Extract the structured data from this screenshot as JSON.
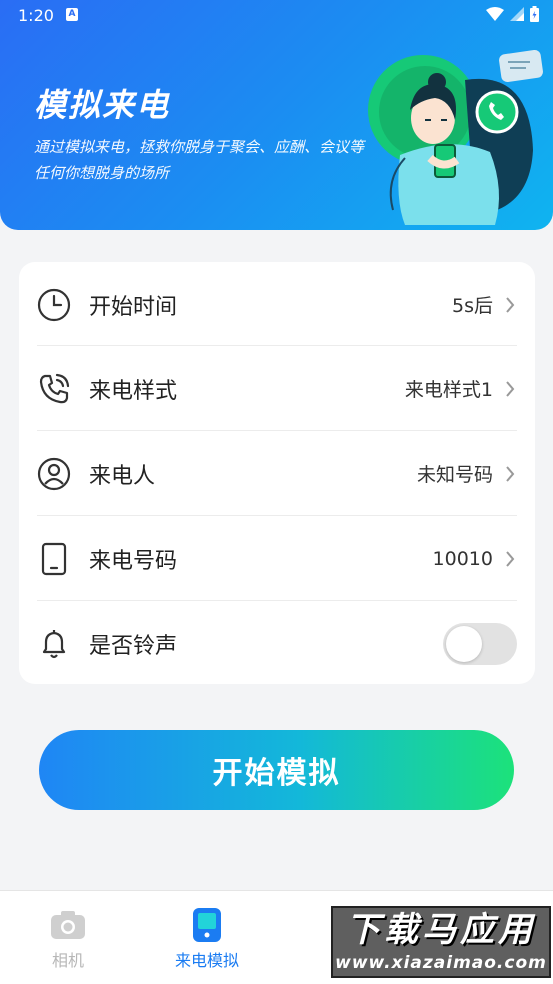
{
  "status_bar": {
    "time": "1:20",
    "notif_glyph": "A"
  },
  "hero": {
    "title": "模拟来电",
    "description": "通过模拟来电，拯救你脱身于聚会、应酬、会议等任何你想脱身的场所"
  },
  "settings": [
    {
      "icon": "clock-icon",
      "label": "开始时间",
      "value": "5s后"
    },
    {
      "icon": "phone-ring-icon",
      "label": "来电样式",
      "value": "来电样式1"
    },
    {
      "icon": "user-icon",
      "label": "来电人",
      "value": "未知号码"
    },
    {
      "icon": "tablet-icon",
      "label": "来电号码",
      "value": "10010"
    },
    {
      "icon": "bell-icon",
      "label": "是否铃声",
      "toggle": false
    }
  ],
  "start_button": "开始模拟",
  "bottom_nav": [
    {
      "icon": "camera-icon",
      "label": "相机",
      "active": false
    },
    {
      "icon": "phone-card-icon",
      "label": "来电模拟",
      "active": true
    }
  ],
  "watermark": {
    "big": "下载马应用",
    "small": "www.xiazaimao.com"
  },
  "colors": {
    "accent": "#1f86f5",
    "active_nav": "#1b7cf2",
    "inactive_nav": "#b7b7b7"
  }
}
